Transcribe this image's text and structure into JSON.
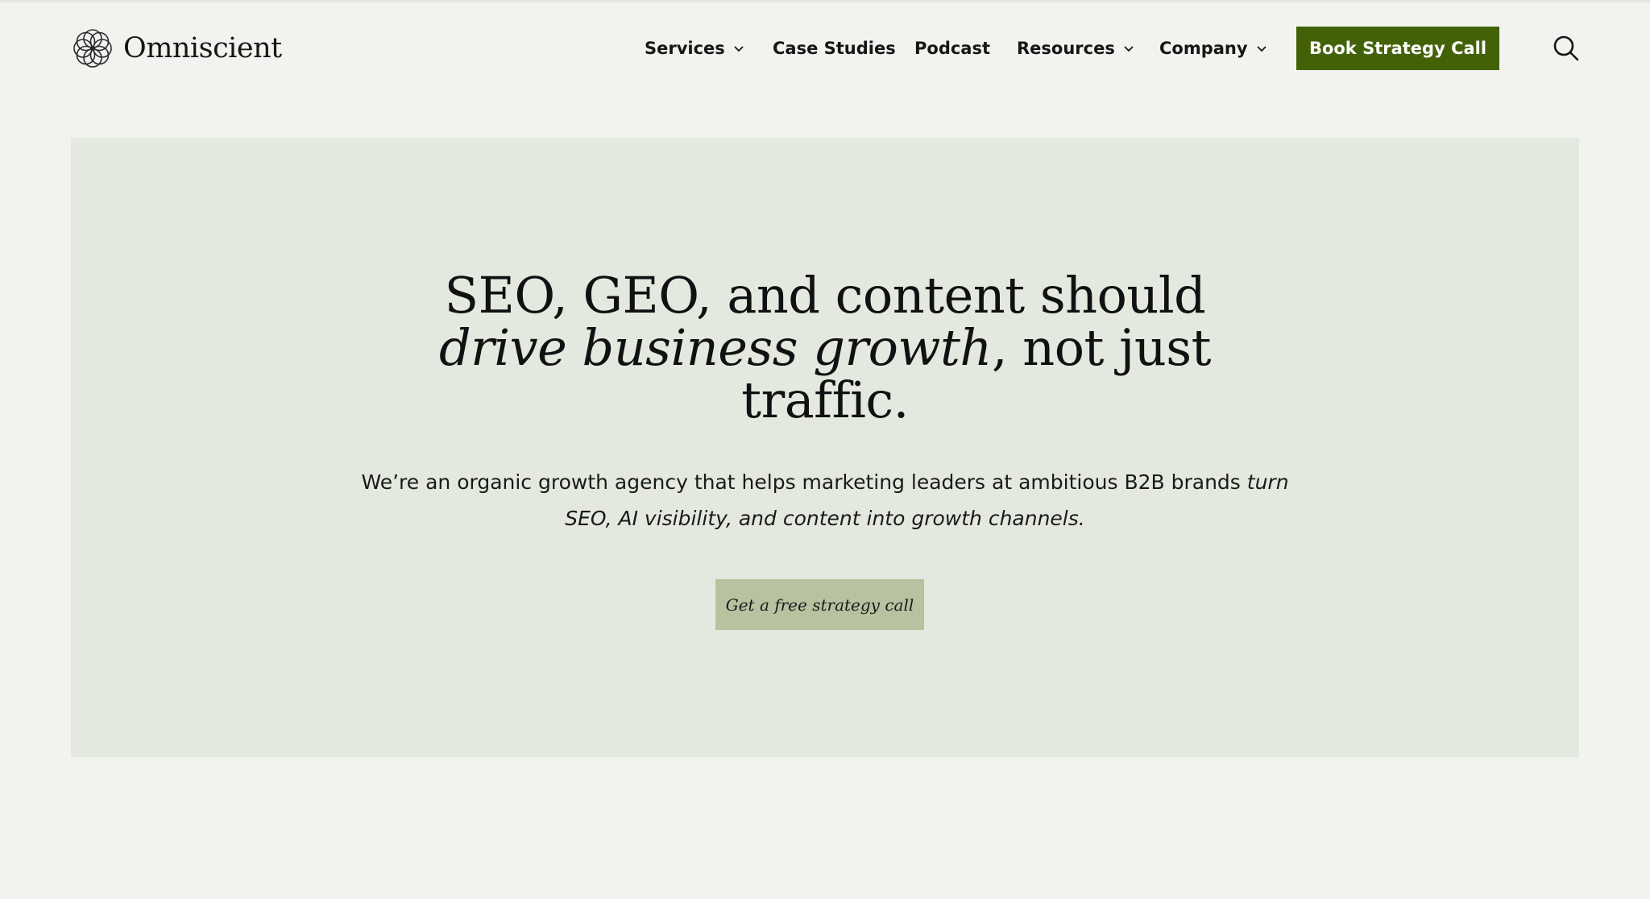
{
  "brand": {
    "name": "Omniscient",
    "logo_icon": "interlocking-rings-icon"
  },
  "nav": {
    "items": [
      {
        "label": "Services",
        "has_dropdown": true
      },
      {
        "label": "Case Studies",
        "has_dropdown": false
      },
      {
        "label": "Podcast",
        "has_dropdown": false
      },
      {
        "label": "Resources",
        "has_dropdown": true
      },
      {
        "label": "Company",
        "has_dropdown": true
      }
    ],
    "cta_label": "Book Strategy Call",
    "search_icon": "search-icon"
  },
  "hero": {
    "title_line1": "SEO, GEO, and content should",
    "title_emphasis": "drive business growth",
    "title_rest": ", not just",
    "title_line3": "traffic.",
    "subtitle_plain": "We’re an organic growth agency that helps marketing leaders at ambitious B2B brands",
    "subtitle_emphasis_1": "turn",
    "subtitle_emphasis_2": "SEO, AI visibility, and content into growth channels.",
    "cta_label": "Get a free strategy call"
  },
  "colors": {
    "page_bg": "#f2f3ee",
    "hero_bg": "#e4e9df",
    "primary_green": "#436207",
    "hero_button_bg": "#b6c2a0",
    "text": "#111111"
  }
}
